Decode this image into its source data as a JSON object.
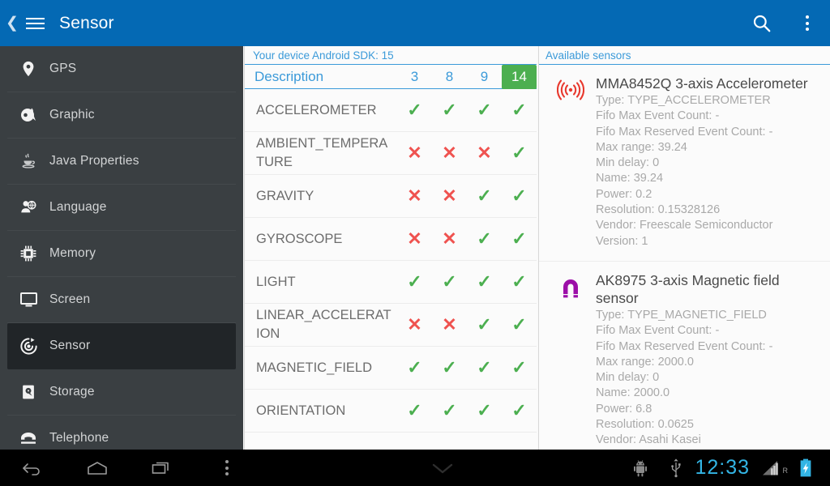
{
  "actionbar": {
    "back_icon": "back-chevron-icon",
    "menu_icon": "hamburger-menu-icon",
    "title": "Sensor",
    "search_icon": "search-icon",
    "overflow_icon": "overflow-menu-icon"
  },
  "sidebar": {
    "items": [
      {
        "label": "GPS",
        "icon": "location-pin-icon",
        "selected": false
      },
      {
        "label": "Graphic",
        "icon": "graphic-icon",
        "selected": false
      },
      {
        "label": "Java Properties",
        "icon": "java-coffee-icon",
        "selected": false
      },
      {
        "label": "Language",
        "icon": "language-person-icon",
        "selected": false
      },
      {
        "label": "Memory",
        "icon": "memory-chip-icon",
        "selected": false
      },
      {
        "label": "Screen",
        "icon": "monitor-icon",
        "selected": false
      },
      {
        "label": "Sensor",
        "icon": "sensor-target-icon",
        "selected": true
      },
      {
        "label": "Storage",
        "icon": "hard-disk-icon",
        "selected": false
      },
      {
        "label": "Telephone",
        "icon": "telephone-icon",
        "selected": false
      }
    ]
  },
  "middle": {
    "sdk_line": "Your device Android SDK: 15",
    "columns": [
      {
        "label": "Description",
        "highlight": false
      },
      {
        "label": "3",
        "highlight": false
      },
      {
        "label": "8",
        "highlight": false
      },
      {
        "label": "9",
        "highlight": false
      },
      {
        "label": "14",
        "highlight": true
      }
    ],
    "rows": [
      {
        "name": "ACCELEROMETER",
        "values": [
          "ok",
          "ok",
          "ok",
          "ok"
        ]
      },
      {
        "name": "AMBIENT_TEMPERATURE",
        "values": [
          "no",
          "no",
          "no",
          "ok"
        ]
      },
      {
        "name": "GRAVITY",
        "values": [
          "no",
          "no",
          "ok",
          "ok"
        ]
      },
      {
        "name": "GYROSCOPE",
        "values": [
          "no",
          "no",
          "ok",
          "ok"
        ]
      },
      {
        "name": "LIGHT",
        "values": [
          "ok",
          "ok",
          "ok",
          "ok"
        ]
      },
      {
        "name": "LINEAR_ACCELERATION",
        "values": [
          "no",
          "no",
          "ok",
          "ok"
        ]
      },
      {
        "name": "MAGNETIC_FIELD",
        "values": [
          "ok",
          "ok",
          "ok",
          "ok"
        ]
      },
      {
        "name": "ORIENTATION",
        "values": [
          "ok",
          "ok",
          "ok",
          "ok"
        ]
      }
    ],
    "marks": {
      "ok": "✓",
      "no": "✕"
    }
  },
  "right": {
    "header": "Available sensors",
    "sensors": [
      {
        "icon": "vibration-waves-icon",
        "icon_color": "#e8392e",
        "title": "MMA8452Q 3-axis Accelerometer",
        "lines": [
          "Type: TYPE_ACCELEROMETER",
          "Fifo Max Event Count: -",
          "Fifo Max Reserved Event Count: -",
          "Max range: 39.24",
          "Min delay: 0",
          "Name: 39.24",
          "Power: 0.2",
          "Resolution: 0.15328126",
          "Vendor: Freescale Semiconductor",
          "Version: 1"
        ]
      },
      {
        "icon": "magnet-icon",
        "icon_color": "#9c0fa8",
        "title": "AK8975 3-axis Magnetic field sensor",
        "lines": [
          "Type: TYPE_MAGNETIC_FIELD",
          "Fifo Max Event Count: -",
          "Fifo Max Reserved Event Count: -",
          "Max range: 2000.0",
          "Min delay: 0",
          "Name: 2000.0",
          "Power: 6.8",
          "Resolution: 0.0625",
          "Vendor: Asahi Kasei"
        ]
      }
    ]
  },
  "systembar": {
    "back_icon": "nav-back-icon",
    "home_icon": "nav-home-icon",
    "recents_icon": "nav-recents-icon",
    "menu_icon": "nav-menu-icon",
    "chevron_icon": "chevron-down-icon",
    "android_icon": "android-robot-icon",
    "usb_icon": "usb-icon",
    "clock": "12:33",
    "roaming_label": "R",
    "signal_icon": "signal-bars-icon",
    "battery_icon": "battery-charging-icon"
  },
  "colors": {
    "accent_blue": "#0469b4",
    "link_blue": "#3b9ad9",
    "ok_green": "#4caf50",
    "no_red": "#ef5350",
    "sidebar_bg": "#3a3f42",
    "status_blue": "#33b5e5"
  }
}
